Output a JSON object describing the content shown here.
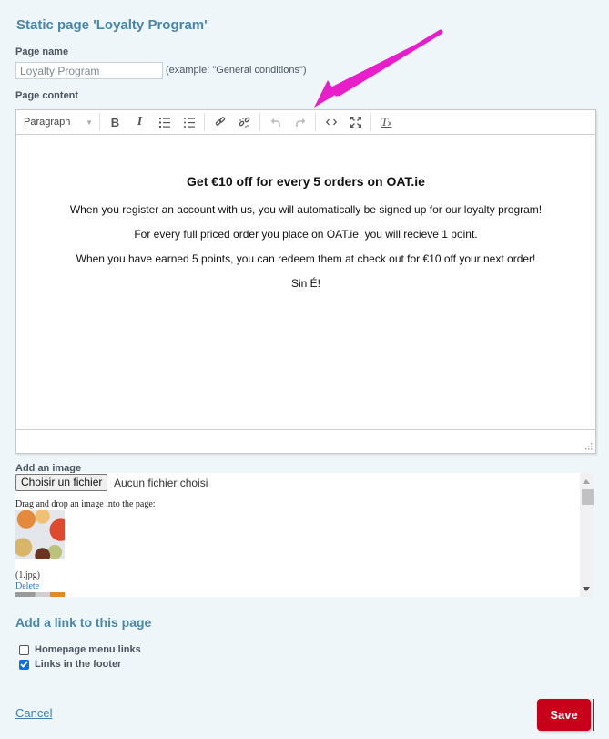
{
  "page_title": "Static page 'Loyalty Program'",
  "page_name": {
    "label": "Page name",
    "value": "Loyalty Program",
    "hint": "(example: \"General conditions\")"
  },
  "page_content": {
    "label": "Page content",
    "toolbar": {
      "format_select": "Paragraph",
      "buttons": [
        {
          "name": "bold",
          "icon": "bold-icon",
          "glyph": "B",
          "enabled": true
        },
        {
          "name": "italic",
          "icon": "italic-icon",
          "glyph": "I",
          "enabled": true
        },
        {
          "name": "numbered-list",
          "icon": "numbered-list-icon",
          "enabled": true
        },
        {
          "name": "bullet-list",
          "icon": "bullet-list-icon",
          "enabled": true
        },
        {
          "name": "link",
          "icon": "link-icon",
          "enabled": true
        },
        {
          "name": "unlink",
          "icon": "unlink-icon",
          "enabled": true
        },
        {
          "name": "undo",
          "icon": "undo-icon",
          "enabled": false
        },
        {
          "name": "redo",
          "icon": "redo-icon",
          "enabled": false
        },
        {
          "name": "source-code",
          "icon": "code-icon",
          "glyph": "<>",
          "enabled": true
        },
        {
          "name": "fullscreen",
          "icon": "fullscreen-icon",
          "enabled": true
        },
        {
          "name": "clear-formatting",
          "icon": "clear-format-icon",
          "glyph": "Tx",
          "enabled": true
        }
      ]
    },
    "heading": "Get €10 off for every 5 orders on OAT.ie",
    "paragraphs": [
      "When you register an account with us, you will automatically be signed up for our loyalty program!",
      "For every full priced order you place on OAT.ie, you will recieve 1 point.",
      "When you have earned 5 points, you can redeem them at check out for €10 off your next order!",
      "Sin É!"
    ]
  },
  "image_upload": {
    "label": "Add an image",
    "choose_button": "Choisir un fichier",
    "file_status": "Aucun fichier choisi",
    "drag_drop_text": "Drag and drop an image into the page:",
    "images": [
      {
        "filename": "(1.jpg)",
        "delete_label": "Delete"
      }
    ]
  },
  "links": {
    "title": "Add a link to this page",
    "options": [
      {
        "label": "Homepage menu links",
        "checked": false
      },
      {
        "label": "Links in the footer",
        "checked": true
      }
    ]
  },
  "actions": {
    "cancel_label": "Cancel",
    "save_label": "Save"
  },
  "annotation": {
    "color": "#e81ecb",
    "points_to": "source-code"
  }
}
